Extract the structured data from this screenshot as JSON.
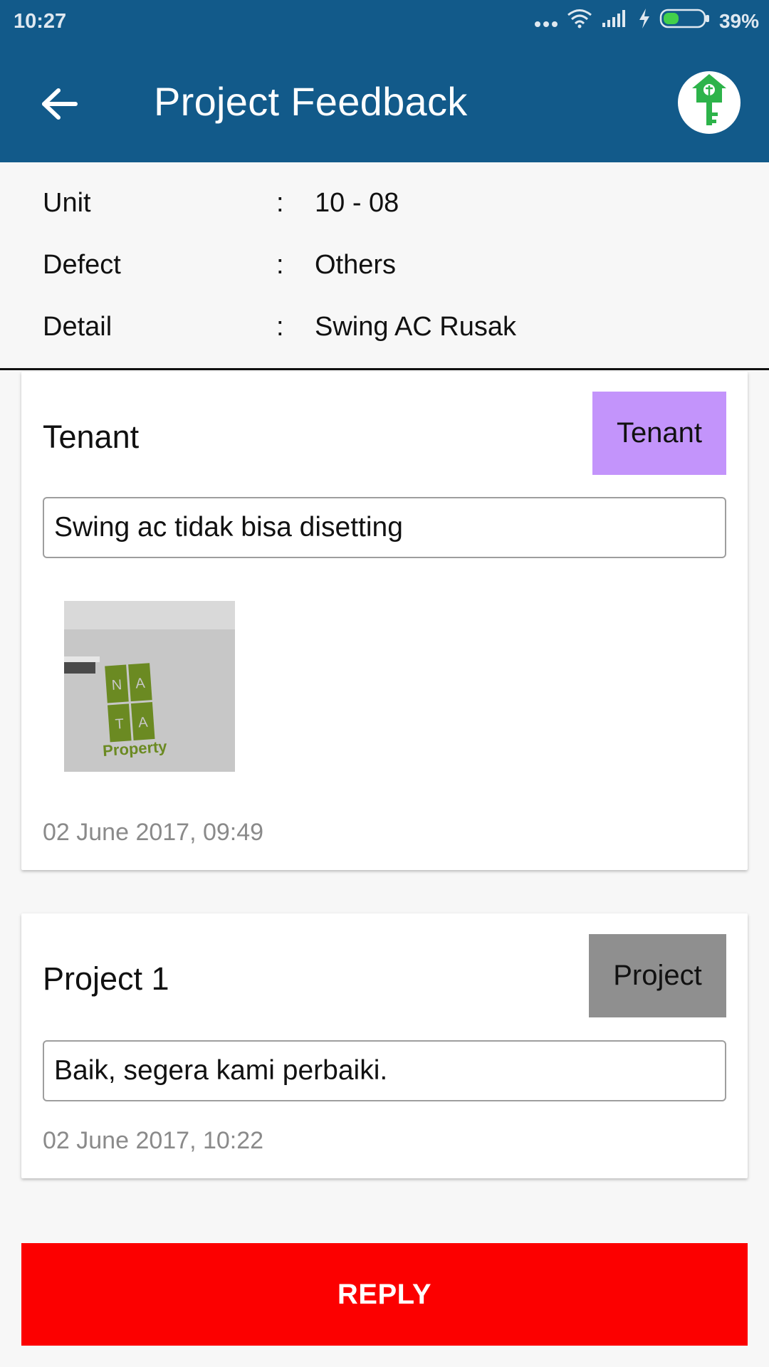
{
  "status_bar": {
    "time": "10:27",
    "battery_percent": "39%",
    "battery_level": 0.39,
    "icons": [
      "more-dots-icon",
      "wifi-icon",
      "signal-icon",
      "charging-icon",
      "battery-icon"
    ]
  },
  "app_bar": {
    "title": "Project Feedback",
    "back_icon": "arrow-left-icon",
    "logo_icon": "house-key-logo-icon",
    "color": "#125a8a"
  },
  "info": {
    "rows": [
      {
        "label": "Unit",
        "colon": ":",
        "value": "10 - 08"
      },
      {
        "label": "Defect",
        "colon": ":",
        "value": "Others"
      },
      {
        "label": "Detail",
        "colon": ":",
        "value": "Swing AC Rusak"
      }
    ]
  },
  "feedback": [
    {
      "name": "Tenant",
      "role": "Tenant",
      "role_color": "#c394fb",
      "message": "Swing ac tidak bisa disetting",
      "attachment": {
        "has_image": true,
        "logo_letters": [
          "N",
          "A",
          "T",
          "A"
        ],
        "logo_text": "Property"
      },
      "date": "02 June 2017, 09:49"
    },
    {
      "name": "Project 1",
      "role": "Project",
      "role_color": "#8f8f8f",
      "message": "Baik, segera kami perbaiki.",
      "date": "02 June 2017, 10:22"
    }
  ],
  "reply_button": {
    "label": "REPLY",
    "color": "#fc0000"
  }
}
